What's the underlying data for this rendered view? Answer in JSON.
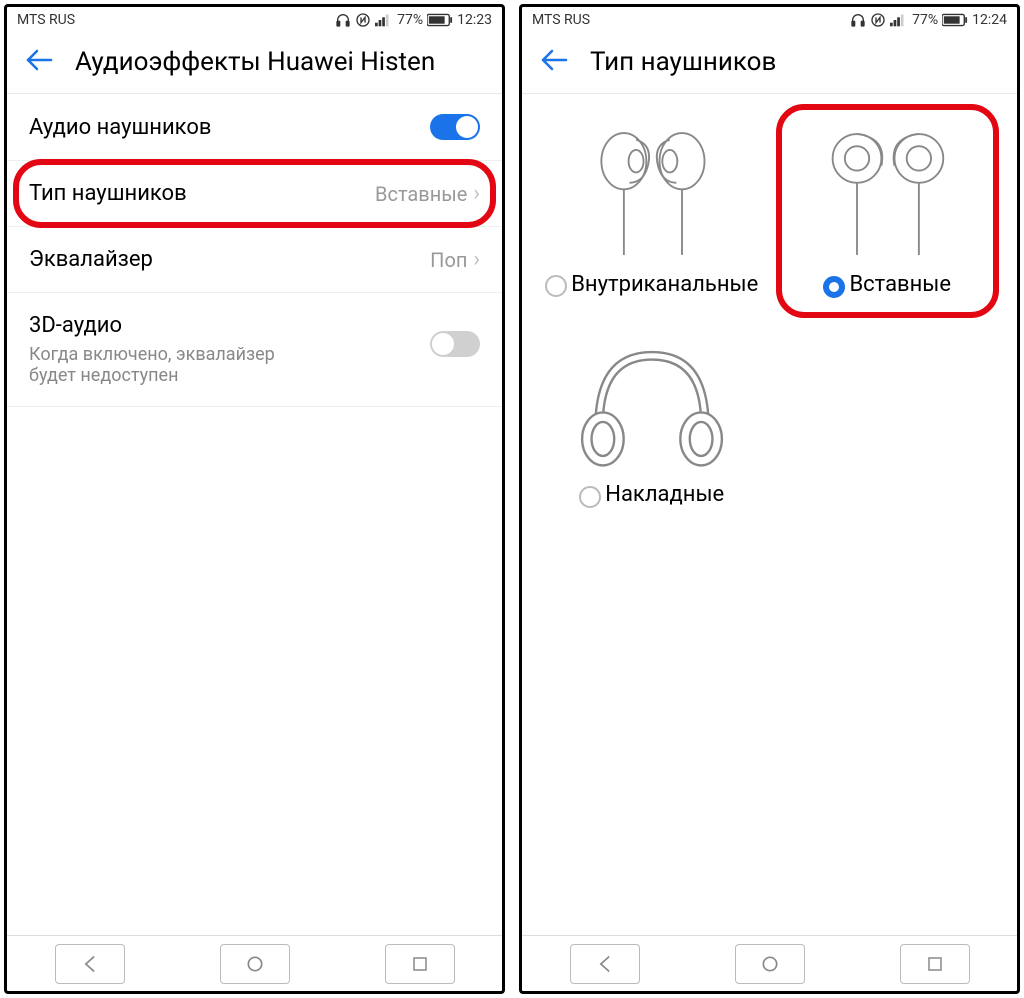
{
  "left": {
    "status": {
      "carrier": "MTS RUS",
      "battery": "77%",
      "time": "12:23"
    },
    "title": "Аудиоэффекты Huawei Histen",
    "rows": {
      "audio": {
        "label": "Аудио наушников"
      },
      "type": {
        "label": "Тип наушников",
        "value": "Вставные"
      },
      "eq": {
        "label": "Эквалайзер",
        "value": "Поп"
      },
      "threeD": {
        "label": "3D-аудио",
        "desc": "Когда включено, эквалайзер будет недоступен"
      }
    }
  },
  "right": {
    "status": {
      "carrier": "MTS RUS",
      "battery": "77%",
      "time": "12:24"
    },
    "title": "Тип наушников",
    "options": {
      "inear": "Внутриканальные",
      "earbud": "Вставные",
      "overear": "Накладные"
    }
  }
}
